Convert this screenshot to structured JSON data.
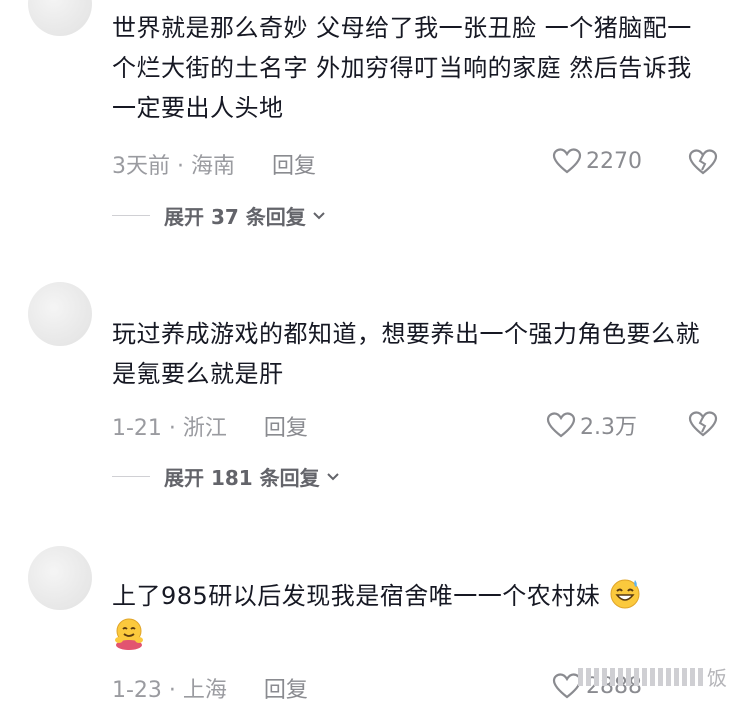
{
  "comments": [
    {
      "text": "世界就是那么奇妙 父母给了我一张丑脸 一个猪脑配一个烂大街的土名字 外加穷得叮当响的家庭 然后告诉我一定要出人头地",
      "time_location": "3天前 · 海南",
      "reply_label": "回复",
      "likes": "2270",
      "expand_label": "展开 37 条回复"
    },
    {
      "text": "玩过养成游戏的都知道，想要养出一个强力角色要么就是氪要么就是肝",
      "time_location": "1-21 · 浙江",
      "reply_label": "回复",
      "likes": "2.3万",
      "expand_label": "展开 181 条回复"
    },
    {
      "text": "上了985研以后发现我是宿舍唯一一个农村妹",
      "time_location": "1-23 · 上海",
      "reply_label": "回复",
      "likes": "2888"
    }
  ],
  "icons": {
    "like": "heart-outline-icon",
    "dislike": "broken-heart-icon",
    "expand": "chevron-down-icon",
    "emoji_1": "grinning-sweat-emoji",
    "emoji_2": "hugging-face-emoji"
  },
  "watermark": "饭",
  "colors": {
    "text": "#161823",
    "meta": "#9a9ba0",
    "expand": "#63646a"
  }
}
